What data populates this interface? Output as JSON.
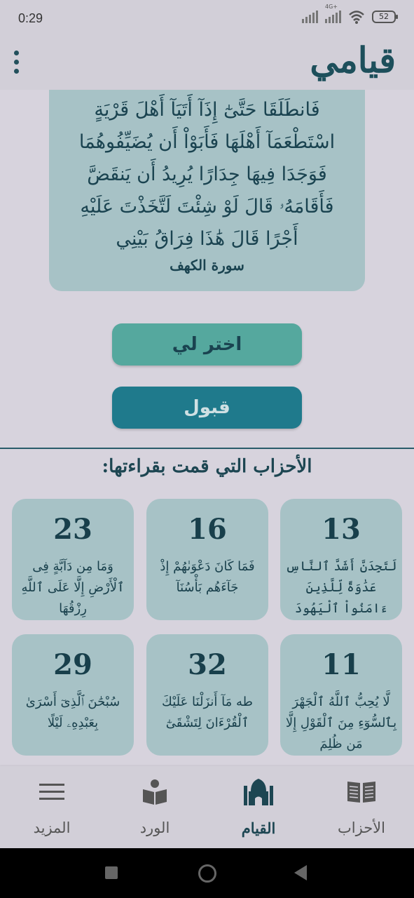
{
  "status": {
    "time": "0:29",
    "network": "4G+",
    "battery": "52"
  },
  "app": {
    "title": "قيامي"
  },
  "ayah": {
    "text": "فَانطَلَقَا حَتَّىٰٓ إِذَآ أَتَيَآ أَهْلَ قَرْيَةٍ اسْتَطْعَمَآ أَهْلَهَا فَأَبَوْاْ أَن يُضَيِّفُوهُمَا فَوَجَدَا فِيهَا جِدَارًا يُرِيدُ أَن يَنقَضَّ فَأَقَامَهُۥ قَالَ لَوْ شِئْتَ لَتَّخَذْتَ عَلَيْهِ أَجْرًا قَالَ هَٰذَا فِرَاقُ بَيْنِي",
    "surah": "سورة الكهف"
  },
  "buttons": {
    "choose": "اختر لي",
    "accept": "قبول"
  },
  "section_title": "الأحزاب التي قمت بقراءتها:",
  "hizb_cards": [
    {
      "number": "13",
      "text": "لَتَجِدَنَّ أَشَدَّ ٱلنَّاسِ عَدَٰوَةً لِّلَّذِينَ ءَامَنُواْ ٱلْيَهُودَ"
    },
    {
      "number": "16",
      "text": "فَمَا كَانَ دَعْوَىٰهُمْ إِذْ جَآءَهُم بَأْسُنَآ"
    },
    {
      "number": "23",
      "text": "وَمَا مِن دَآبَّةٍ فِى ٱلْأَرْضِ إِلَّا عَلَى ٱللَّهِ رِزْقُهَا"
    },
    {
      "number": "11",
      "text": "لَّا يُحِبُّ ٱللَّهُ ٱلْجَهْرَ بِٱلسُّوٓءِ مِنَ ٱلْقَوْلِ إِلَّا مَن ظُلِمَ"
    },
    {
      "number": "32",
      "text": "طه مَآ أَنزَلْنَا عَلَيْكَ ٱلْقُرْءَانَ لِتَشْقَىٰٓ"
    },
    {
      "number": "29",
      "text": "سُبْحَٰنَ ٱلَّذِىٓ أَسْرَىٰ بِعَبْدِهِۦ لَيْلًا"
    }
  ],
  "nav": {
    "ahzab": "الأحزاب",
    "qiyam": "القيام",
    "wird": "الورد",
    "more": "المزيد"
  }
}
